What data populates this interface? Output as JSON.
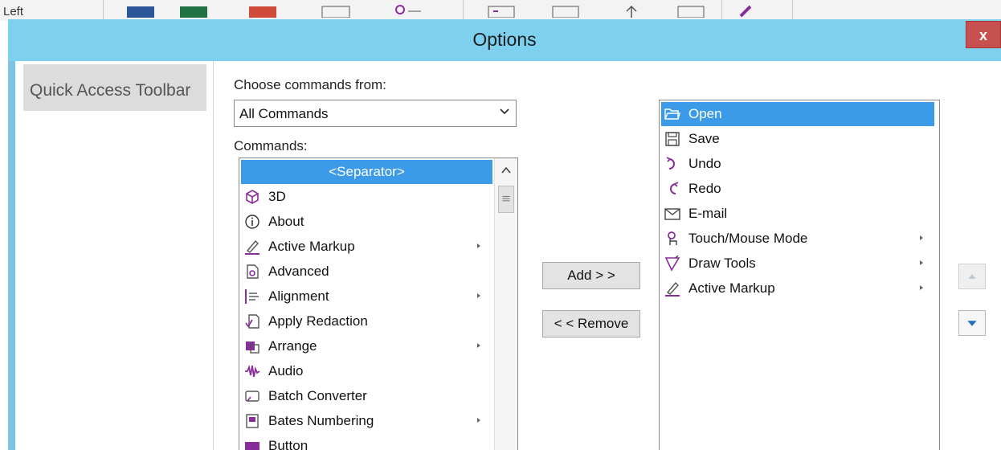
{
  "ribbon": {
    "left_label": "Left"
  },
  "dialog": {
    "title": "Options",
    "close_label": "x"
  },
  "nav": {
    "items": [
      {
        "label": "Quick Access Toolbar"
      }
    ]
  },
  "choose": {
    "label": "Choose commands from:",
    "selected": "All Commands"
  },
  "commands": {
    "label": "Commands:",
    "items": [
      {
        "label": "<Separator>",
        "icon": "none",
        "selected": true
      },
      {
        "label": "3D",
        "icon": "cube-icon"
      },
      {
        "label": "About",
        "icon": "info-icon"
      },
      {
        "label": "Active Markup",
        "icon": "pen-icon",
        "submenu": true
      },
      {
        "label": "Advanced",
        "icon": "document-gear-icon"
      },
      {
        "label": "Alignment",
        "icon": "align-icon",
        "submenu": true
      },
      {
        "label": "Apply Redaction",
        "icon": "redaction-icon"
      },
      {
        "label": "Arrange",
        "icon": "arrange-icon",
        "submenu": true
      },
      {
        "label": "Audio",
        "icon": "audio-wave-icon"
      },
      {
        "label": "Batch Converter",
        "icon": "batch-converter-icon"
      },
      {
        "label": "Bates Numbering",
        "icon": "bates-numbering-icon",
        "submenu": true
      },
      {
        "label": "Button",
        "icon": "button-icon"
      }
    ]
  },
  "buttons": {
    "add_label": "Add > >",
    "remove_label": "< < Remove"
  },
  "toolbar_list": {
    "items": [
      {
        "label": "Open",
        "icon": "folder-open-icon",
        "selected": true
      },
      {
        "label": "Save",
        "icon": "save-icon"
      },
      {
        "label": "Undo",
        "icon": "undo-icon"
      },
      {
        "label": "Redo",
        "icon": "redo-icon"
      },
      {
        "label": "E-mail",
        "icon": "email-icon"
      },
      {
        "label": "Touch/Mouse Mode",
        "icon": "touch-icon",
        "submenu": true
      },
      {
        "label": "Draw Tools",
        "icon": "draw-tools-icon",
        "submenu": true
      },
      {
        "label": "Active Markup",
        "icon": "pen-icon",
        "submenu": true
      }
    ]
  },
  "colors": {
    "title_bar": "#7dd1ee",
    "selection": "#3c9be8",
    "icon_purple": "#8a2d9c",
    "close_red": "#c75050"
  }
}
